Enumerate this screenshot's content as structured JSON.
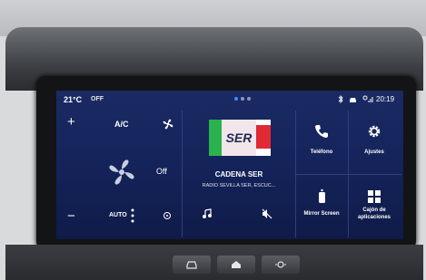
{
  "status_bar": {
    "temperature": "21°C",
    "climate_state": "OFF",
    "clock": "20:19"
  },
  "climate": {
    "plus": "+",
    "minus": "−",
    "ac_label": "A/C",
    "fan_state": "Off",
    "auto_label": "AUTO"
  },
  "media": {
    "logo_text": "SER",
    "station_name": "CADENA SER",
    "station_info": "RADIO SEVILLA SER, ESCUC..."
  },
  "apps": [
    {
      "label": "Teléfono",
      "icon": "phone-icon"
    },
    {
      "label": "Ajustes",
      "icon": "gear-icon"
    },
    {
      "label": "Mirror Screen",
      "icon": "mirror-screen-icon"
    },
    {
      "label": "Cajón de aplicaciones",
      "icon": "app-drawer-icon"
    }
  ],
  "colors": {
    "screen_bg": "#14235a",
    "accent_blue": "#3d8cff",
    "logo_green": "#2bb24c",
    "logo_red": "#e02a36"
  }
}
